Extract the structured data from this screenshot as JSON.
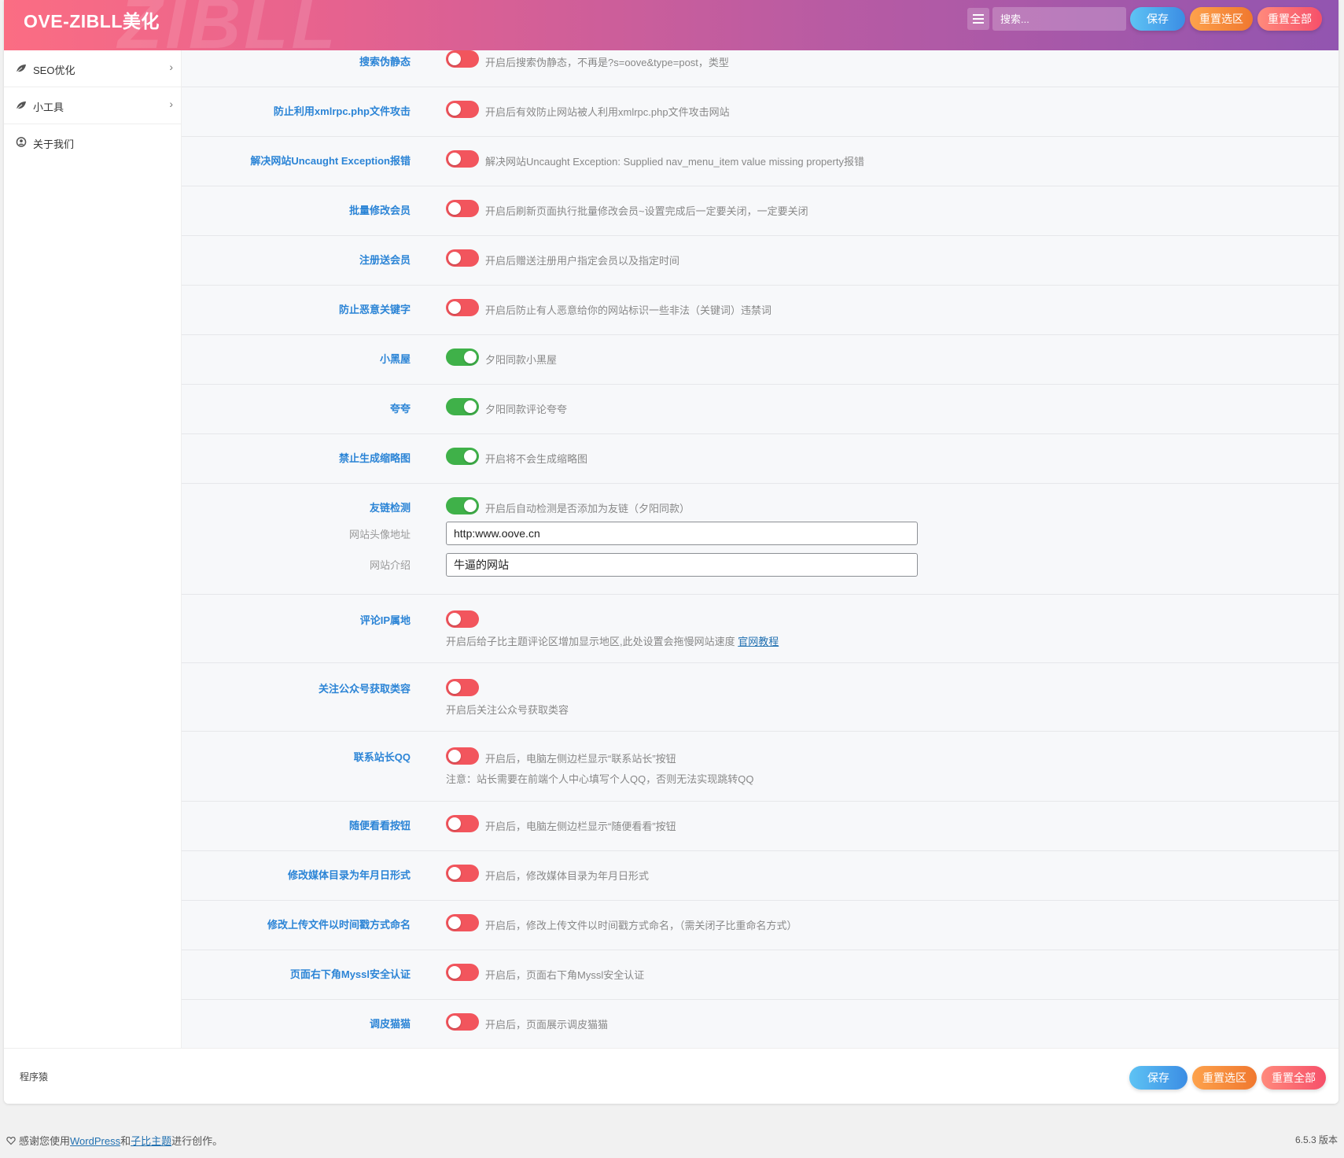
{
  "header": {
    "title": "OVE-ZIBLL美化",
    "watermark": "ZIBLL",
    "search_placeholder": "搜索...",
    "save": "保存",
    "reset_section": "重置选区",
    "reset_all": "重置全部"
  },
  "sidebar": {
    "items": [
      {
        "label": "SEO优化",
        "icon": "leaf-icon",
        "chevron": "›"
      },
      {
        "label": "小工具",
        "icon": "leaf-icon",
        "chevron": "›"
      },
      {
        "label": "关于我们",
        "icon": "user-circle-icon",
        "chevron": ""
      }
    ]
  },
  "settings": {
    "search_static": {
      "label": "搜索伪静态",
      "enabled": false,
      "desc": "开启后搜索伪静态，不再是?s=oove&type=post，类型"
    },
    "xmlrpc": {
      "label": "防止利用xmlrpc.php文件攻击",
      "enabled": false,
      "desc": "开启后有效防止网站被人利用xmlrpc.php文件攻击网站"
    },
    "uncaught": {
      "label": "解决网站Uncaught Exception报错",
      "enabled": false,
      "desc": "解决网站Uncaught Exception: Supplied nav_menu_item value missing property报错"
    },
    "batch_member": {
      "label": "批量修改会员",
      "enabled": false,
      "desc": "开启后刷新页面执行批量修改会员~设置完成后一定要关闭，一定要关闭"
    },
    "register_member": {
      "label": "注册送会员",
      "enabled": false,
      "desc": "开启后赠送注册用户指定会员以及指定时间"
    },
    "bad_keywords": {
      "label": "防止恶意关键字",
      "enabled": false,
      "desc": "开启后防止有人恶意给你的网站标识一些非法（关键词）违禁词"
    },
    "blackroom": {
      "label": "小黑屋",
      "enabled": true,
      "desc": "夕阳同款小黑屋"
    },
    "kuakua": {
      "label": "夸夸",
      "enabled": true,
      "desc": "夕阳同款评论夸夸"
    },
    "no_thumb": {
      "label": "禁止生成缩略图",
      "enabled": true,
      "desc": "开启将不会生成缩略图"
    },
    "friend_link": {
      "label": "友链检测",
      "enabled": true,
      "desc": "开启后自动检测是否添加为友链（夕阳同款）",
      "avatar_label": "网站头像地址",
      "avatar_value": "http:www.oove.cn",
      "intro_label": "网站介绍",
      "intro_value": "牛逼的网站"
    },
    "comment_ip": {
      "label": "评论IP属地",
      "enabled": false,
      "desc": "开启后给子比主题评论区增加显示地区,此处设置会拖慢网站速度",
      "link": "官网教程"
    },
    "wechat_follow": {
      "label": "关注公众号获取类容",
      "enabled": false,
      "desc": "开启后关注公众号获取类容"
    },
    "contact_qq": {
      "label": "联系站长QQ",
      "enabled": false,
      "desc": "开启后，电脑左侧边栏显示“联系站长”按钮",
      "note": "注意：站长需要在前端个人中心填写个人QQ，否则无法实现跳转QQ"
    },
    "random_view": {
      "label": "随便看看按钮",
      "enabled": false,
      "desc": "开启后，电脑左侧边栏显示“随便看看”按钮"
    },
    "media_dir": {
      "label": "修改媒体目录为年月日形式",
      "enabled": false,
      "desc": "开启后，修改媒体目录为年月日形式"
    },
    "upload_timestamp": {
      "label": "修改上传文件以时间戳方式命名",
      "enabled": false,
      "desc": "开启后，修改上传文件以时间戳方式命名，（需关闭子比重命名方式）"
    },
    "myssl": {
      "label": "页面右下角Myssl安全认证",
      "enabled": false,
      "desc": "开启后，页面右下角Myssl安全认证"
    },
    "cat": {
      "label": "调皮猫猫",
      "enabled": false,
      "desc": "开启后，页面展示调皮猫猫"
    }
  },
  "footer": {
    "brand": "程序猿",
    "save": "保存",
    "reset_section": "重置选区",
    "reset_all": "重置全部"
  },
  "wp_footer": {
    "text_before": "感谢您使用",
    "wordpress": "WordPress",
    "and": "和",
    "theme": "子比主题",
    "text_after": "进行创作。",
    "version": "6.5.3 版本"
  },
  "colors": {
    "accent_blue": "#2b84d6",
    "toggle_off": "#f2555d",
    "toggle_on": "#3fb149",
    "header_start": "#fb6d83",
    "header_end": "#9255b0"
  }
}
